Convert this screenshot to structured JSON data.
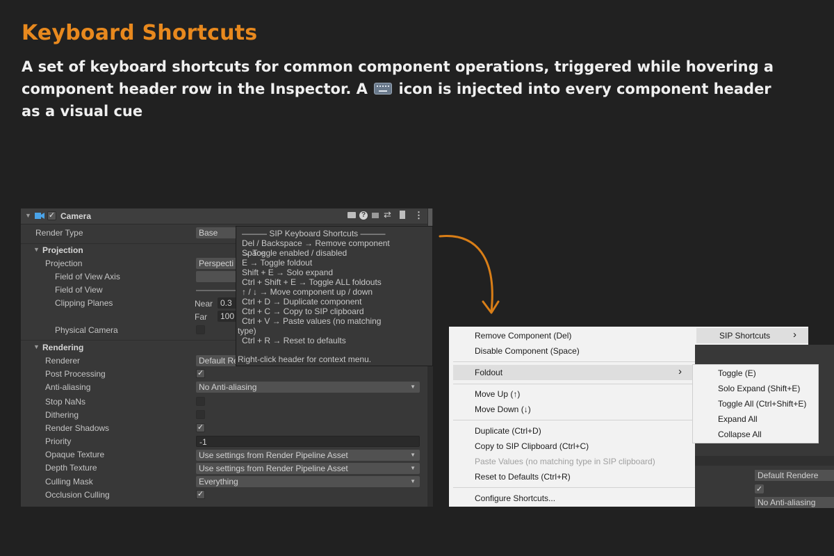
{
  "heading": {
    "title": "Keyboard Shortcuts",
    "subtitle_before": "A set of keyboard shortcuts for common component operations, triggered while hovering a component header row in the Inspector. A ",
    "subtitle_after": " icon is injected into every component header as a visual cue"
  },
  "inspector": {
    "component_title": "Camera",
    "render_type_label": "Render Type",
    "render_type_value": "Base",
    "projection_section": "Projection",
    "projection_label": "Projection",
    "projection_value": "Perspecti",
    "fov_axis_label": "Field of View Axis",
    "fov_label": "Field of View",
    "clipping_label": "Clipping Planes",
    "near_label": "Near",
    "near_value": "0.3",
    "far_label": "Far",
    "far_value": "100",
    "physical_camera_label": "Physical Camera",
    "rendering_section": "Rendering",
    "renderer_label": "Renderer",
    "renderer_value": "Default Re",
    "post_processing_label": "Post Processing",
    "anti_aliasing_label": "Anti-aliasing",
    "anti_aliasing_value": "No Anti-aliasing",
    "stop_nans_label": "Stop NaNs",
    "dithering_label": "Dithering",
    "render_shadows_label": "Render Shadows",
    "priority_label": "Priority",
    "priority_value": "-1",
    "opaque_texture_label": "Opaque Texture",
    "opaque_texture_value": "Use settings from Render Pipeline Asset",
    "depth_texture_label": "Depth Texture",
    "depth_texture_value": "Use settings from Render Pipeline Asset",
    "culling_mask_label": "Culling Mask",
    "culling_mask_value": "Everything",
    "occlusion_culling_label": "Occlusion Culling"
  },
  "tooltip": {
    "title": "——— SIP Keyboard Shortcuts ———",
    "lines": [
      "Del / Backspace       → Remove component",
      "Space",
      "                              → Toggle enabled / disabled",
      "E                   → Toggle foldout",
      "Shift + E              → Solo expand",
      "Ctrl + Shift + E      → Toggle ALL foldouts",
      "↑ / ↓                        → Move component up / down",
      "Ctrl + D                    → Duplicate component",
      "Ctrl + C                    → Copy to SIP clipboard",
      "Ctrl + V                    → Paste values  (no matching",
      "type)",
      "Ctrl + R                    → Reset to defaults"
    ],
    "footer": "Right-click header for context menu."
  },
  "context_menu": {
    "remove": "Remove Component  (Del)",
    "disable": "Disable Component  (Space)",
    "foldout": "Foldout",
    "move_up": "Move Up  (↑)",
    "move_down": "Move Down  (↓)",
    "duplicate": "Duplicate  (Ctrl+D)",
    "copy": "Copy to SIP Clipboard  (Ctrl+C)",
    "paste": "Paste Values  (no matching type in SIP clipboard)",
    "reset": "Reset to Defaults  (Ctrl+R)",
    "configure": "Configure Shortcuts...",
    "submenu_arrow": "›"
  },
  "sip_submenu": {
    "label": "SIP Shortcuts",
    "arrow": "›"
  },
  "foldout_submenu": {
    "toggle": "Toggle  (E)",
    "solo": "Solo Expand  (Shift+E)",
    "toggle_all": "Toggle All  (Ctrl+Shift+E)",
    "expand_all": "Expand All",
    "collapse_all": "Collapse All"
  },
  "background_panel": {
    "renderer_value": "Default Rendere",
    "anti_aliasing_value": "No Anti-aliasing"
  },
  "colors": {
    "accent": "#e8891e",
    "arrow": "#d97e17"
  }
}
